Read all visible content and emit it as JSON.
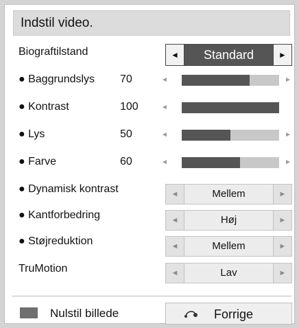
{
  "title": "Indstil video.",
  "mode": {
    "label": "Biograftilstand",
    "value": "Standard"
  },
  "sliders": [
    {
      "label": "● Baggrundslys",
      "value": "70",
      "level": 70
    },
    {
      "label": "● Kontrast",
      "value": "100",
      "level": 100
    },
    {
      "label": "● Lys",
      "value": "50",
      "level": 50
    },
    {
      "label": "● Farve",
      "value": "60",
      "level": 60
    }
  ],
  "options": [
    {
      "label": "● Dynamisk kontrast",
      "value": "Mellem"
    },
    {
      "label": "● Kantforbedring",
      "value": "Høj"
    },
    {
      "label": "● Støjreduktion",
      "value": "Mellem"
    },
    {
      "label": "TruMotion",
      "value": "Lav"
    }
  ],
  "footer": {
    "reset_label": "Nulstil billede",
    "back_label": "Forrige"
  },
  "glyphs": {
    "left": "◄",
    "right": "►"
  }
}
